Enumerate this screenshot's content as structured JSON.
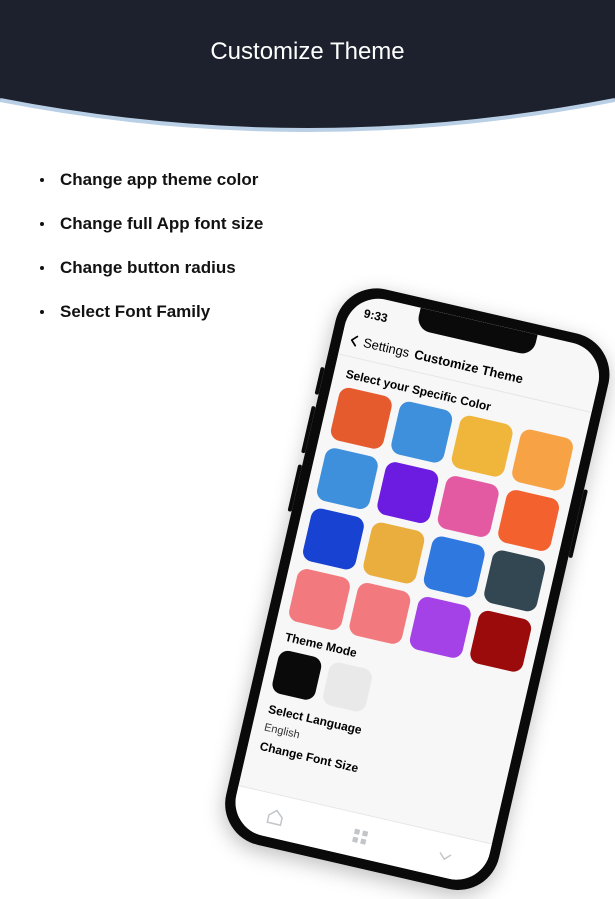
{
  "header": {
    "title": "Customize Theme"
  },
  "features": [
    "Change app theme color",
    "Change full App font size",
    "Change button radius",
    "Select Font Family"
  ],
  "phone": {
    "status_time": "9:33",
    "nav_back": "Settings",
    "nav_title": "Customize Theme",
    "section_color": "Select your Specific Color",
    "colors": [
      "#e55b2e",
      "#3f90dc",
      "#f0b63c",
      "#f6a245",
      "#3f90dc",
      "#6c1be0",
      "#e35aa2",
      "#f3612e",
      "#1742d2",
      "#e9ae3d",
      "#2f78e0",
      "#334752",
      "#f27a7e",
      "#f27a7e",
      "#a442e8",
      "#9b0b0b"
    ],
    "section_mode": "Theme Mode",
    "mode_swatches": [
      "#0a0a0a",
      "#e9e9e9"
    ],
    "section_lang": "Select Language",
    "language": "English",
    "section_font": "Change Font Size"
  }
}
